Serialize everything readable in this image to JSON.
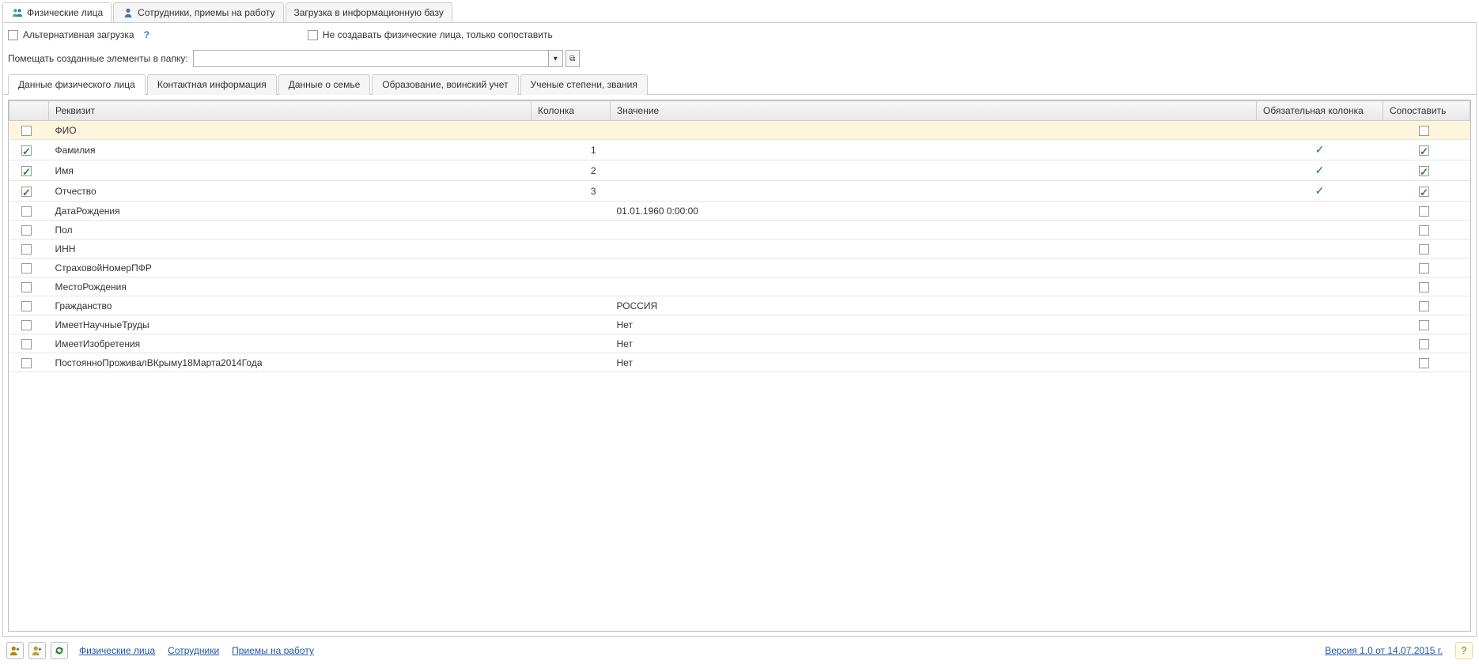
{
  "main_tabs": [
    {
      "label": "Физические лица",
      "active": true,
      "icon": "people-icon"
    },
    {
      "label": "Сотрудники, приемы на работу",
      "active": false,
      "icon": "person-icon"
    },
    {
      "label": "Загрузка в информационную базу",
      "active": false,
      "icon": null
    }
  ],
  "options": {
    "alt_load_label": "Альтернативная загрузка",
    "alt_load_checked": false,
    "no_create_label": "Не создавать физические лица, только сопоставить",
    "no_create_checked": false,
    "help_glyph": "?"
  },
  "folder": {
    "label": "Помещать созданные элементы в папку:",
    "value": "",
    "dropdown_glyph": "▾",
    "open_glyph": "⧉"
  },
  "sub_tabs": [
    {
      "label": "Данные физического лица",
      "active": true
    },
    {
      "label": "Контактная информация",
      "active": false
    },
    {
      "label": "Данные о семье",
      "active": false
    },
    {
      "label": "Образование, воинский учет",
      "active": false
    },
    {
      "label": "Ученые степени, звания",
      "active": false
    }
  ],
  "grid_headers": {
    "chk": "",
    "rekvizit": "Реквизит",
    "kolonka": "Колонка",
    "znachenie": "Значение",
    "oblig": "Обязательная колонка",
    "sopost": "Сопоставить"
  },
  "rows": [
    {
      "checked": false,
      "rekvizit": "ФИО",
      "kolonka": "",
      "znachenie": "",
      "oblig": false,
      "sopost": false,
      "sopost_show": true,
      "selected": true
    },
    {
      "checked": true,
      "rekvizit": "Фамилия",
      "kolonka": "1",
      "znachenie": "",
      "oblig": true,
      "sopost": true,
      "sopost_show": true,
      "selected": false
    },
    {
      "checked": true,
      "rekvizit": "Имя",
      "kolonka": "2",
      "znachenie": "",
      "oblig": true,
      "sopost": true,
      "sopost_show": true,
      "selected": false
    },
    {
      "checked": true,
      "rekvizit": "Отчество",
      "kolonka": "3",
      "znachenie": "",
      "oblig": true,
      "sopost": true,
      "sopost_show": true,
      "selected": false
    },
    {
      "checked": false,
      "rekvizit": "ДатаРождения",
      "kolonka": "",
      "znachenie": "01.01.1960 0:00:00",
      "oblig": false,
      "sopost": false,
      "sopost_show": true,
      "selected": false
    },
    {
      "checked": false,
      "rekvizit": "Пол",
      "kolonka": "",
      "znachenie": "",
      "oblig": false,
      "sopost": false,
      "sopost_show": true,
      "selected": false
    },
    {
      "checked": false,
      "rekvizit": "ИНН",
      "kolonka": "",
      "znachenie": "",
      "oblig": false,
      "sopost": false,
      "sopost_show": true,
      "selected": false
    },
    {
      "checked": false,
      "rekvizit": "СтраховойНомерПФР",
      "kolonka": "",
      "znachenie": "",
      "oblig": false,
      "sopost": false,
      "sopost_show": true,
      "selected": false
    },
    {
      "checked": false,
      "rekvizit": "МестоРождения",
      "kolonka": "",
      "znachenie": "",
      "oblig": false,
      "sopost": false,
      "sopost_show": true,
      "selected": false
    },
    {
      "checked": false,
      "rekvizit": "Гражданство",
      "kolonka": "",
      "znachenie": "РОССИЯ",
      "oblig": false,
      "sopost": false,
      "sopost_show": true,
      "selected": false
    },
    {
      "checked": false,
      "rekvizit": "ИмеетНаучныеТруды",
      "kolonka": "",
      "znachenie": "Нет",
      "oblig": false,
      "sopost": false,
      "sopost_show": true,
      "selected": false
    },
    {
      "checked": false,
      "rekvizit": "ИмеетИзобретения",
      "kolonka": "",
      "znachenie": "Нет",
      "oblig": false,
      "sopost": false,
      "sopost_show": true,
      "selected": false
    },
    {
      "checked": false,
      "rekvizit": "ПостоянноПроживалВКрыму18Марта2014Года",
      "kolonka": "",
      "znachenie": "Нет",
      "oblig": false,
      "sopost": false,
      "sopost_show": true,
      "selected": false
    }
  ],
  "footer": {
    "links": [
      "Физические лица",
      "Сотрудники",
      "Приемы на работу"
    ],
    "version": "Версия 1.0 от 14.07.2015 г.",
    "help_glyph": "?"
  }
}
